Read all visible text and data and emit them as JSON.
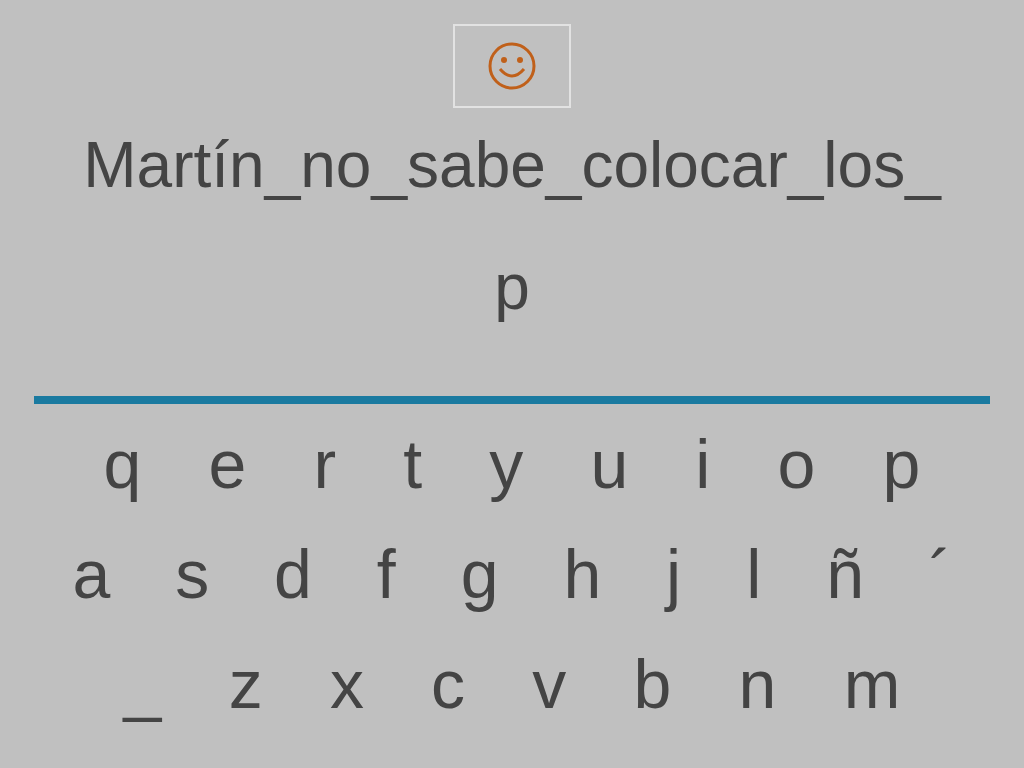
{
  "phrase_lines": [
    "Martín_no_sabe_colocar_los_",
    "p"
  ],
  "keyboard": [
    [
      "q",
      "e",
      "r",
      "t",
      "y",
      "u",
      "i",
      "o",
      "p"
    ],
    [
      "a",
      "s",
      "d",
      "f",
      "g",
      "h",
      "j",
      "l",
      "ñ",
      "´"
    ],
    [
      "_",
      "z",
      "x",
      "c",
      "v",
      "b",
      "n",
      "m"
    ]
  ]
}
